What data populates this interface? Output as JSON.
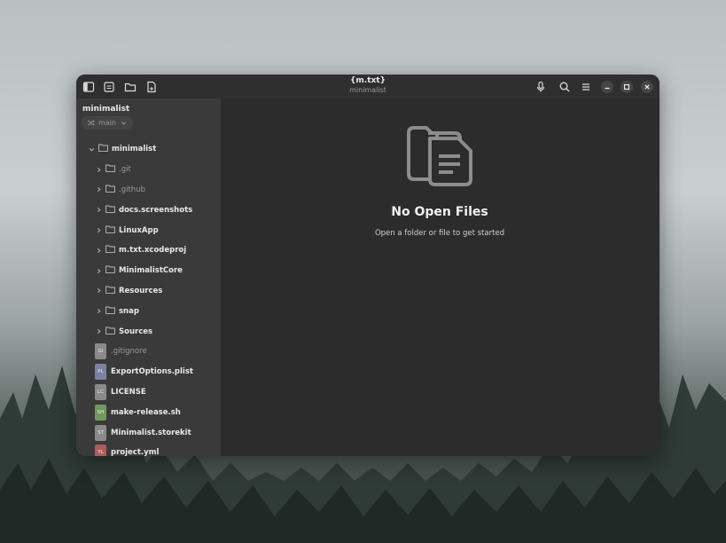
{
  "window": {
    "title": "{m.txt}",
    "subtitle": "minimalist"
  },
  "toolbar": {
    "left_icons": [
      "sidebar-toggle-icon",
      "new-window-icon",
      "open-folder-icon",
      "new-file-icon"
    ],
    "right_icons": [
      "microphone-icon",
      "search-icon",
      "menu-icon"
    ],
    "window_controls": [
      "minimize-icon",
      "maximize-icon",
      "close-icon"
    ]
  },
  "sidebar": {
    "project_name": "minimalist",
    "branch": "main",
    "root": {
      "label": "minimalist",
      "expanded": true
    },
    "folders": [
      {
        "label": ".git",
        "dim": true
      },
      {
        "label": ".github",
        "dim": true
      },
      {
        "label": "docs.screenshots",
        "dim": false
      },
      {
        "label": "LinuxApp",
        "dim": false
      },
      {
        "label": "m.txt.xcodeproj",
        "dim": false
      },
      {
        "label": "MinimalistCore",
        "dim": false
      },
      {
        "label": "Resources",
        "dim": false
      },
      {
        "label": "snap",
        "dim": false
      },
      {
        "label": "Sources",
        "dim": false
      }
    ],
    "files": [
      {
        "badge": "GI",
        "label": ".gitignore",
        "color": "#8a8a8a",
        "dim": true
      },
      {
        "badge": "PL",
        "label": "ExportOptions.plist",
        "color": "#7b82a3",
        "dim": false
      },
      {
        "badge": "LC",
        "label": "LICENSE",
        "color": "#8a8a8a",
        "dim": false
      },
      {
        "badge": "SH",
        "label": "make-release.sh",
        "color": "#6f9b5c",
        "dim": false
      },
      {
        "badge": "ST",
        "label": "Minimalist.storekit",
        "color": "#8a8a8a",
        "dim": false
      },
      {
        "badge": "YL",
        "label": "project.yml",
        "color": "#b55a5a",
        "dim": false
      }
    ]
  },
  "empty_state": {
    "icon": "files-icon",
    "title": "No Open Files",
    "subtitle": "Open a folder or file to get started"
  }
}
